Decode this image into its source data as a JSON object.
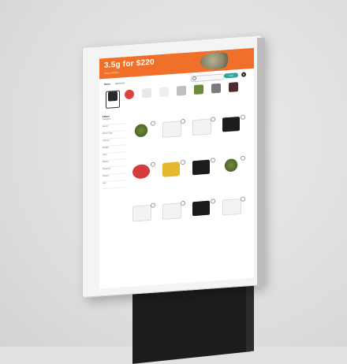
{
  "banner": {
    "headline": "3.5g for $220",
    "subline": "Select Strains"
  },
  "nav": {
    "tabs": [
      "Menu",
      "Specials"
    ],
    "cart_label": "Cart"
  },
  "colors": {
    "accent": "#f0702a",
    "cart": "#2aa6a0",
    "frame": "#f4f4f4",
    "stand": "#1d1d1f"
  },
  "categories": [
    {
      "label": "All",
      "icon": "all-icon"
    },
    {
      "label": "Deals",
      "icon": "deals-icon"
    },
    {
      "label": "Edibles",
      "icon": "edibles-icon"
    },
    {
      "label": "Flower",
      "icon": "flower-icon"
    },
    {
      "label": "Vapes",
      "icon": "vapes-icon"
    },
    {
      "label": "Concentrates",
      "icon": "concentrates-icon"
    },
    {
      "label": "Pre-Rolls",
      "icon": "pre-roll-icon"
    },
    {
      "label": "Topicals",
      "icon": "topicals-icon"
    }
  ],
  "filters": {
    "heading": "Filters",
    "rows": [
      "Category",
      "Brand",
      "Strain Type",
      "Potency",
      "Weight",
      "Price",
      "Effects",
      "Terpenes",
      "Flavors",
      "Sort"
    ]
  },
  "products": [
    {
      "kind": "flower"
    },
    {
      "kind": "jar-white"
    },
    {
      "kind": "jar-white"
    },
    {
      "kind": "jar"
    },
    {
      "kind": "red"
    },
    {
      "kind": "jar-gold"
    },
    {
      "kind": "jar"
    },
    {
      "kind": "flower"
    },
    {
      "kind": "jar-white"
    },
    {
      "kind": "jar-white"
    },
    {
      "kind": "jar"
    },
    {
      "kind": "jar-white"
    }
  ]
}
